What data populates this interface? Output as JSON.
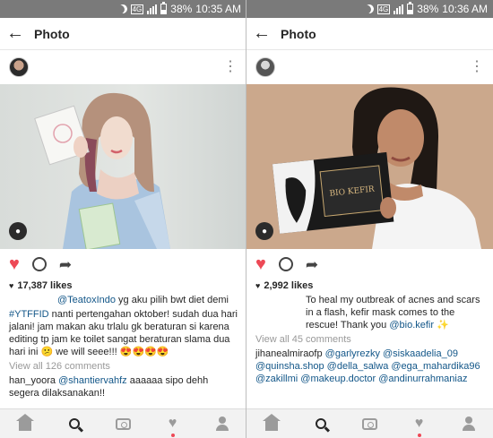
{
  "left": {
    "status": {
      "network": "4G",
      "battery": "38%",
      "time": "10:35 AM"
    },
    "header": {
      "title": "Photo",
      "back_icon": "arrow-left-icon"
    },
    "likes": "17,387 likes",
    "caption": {
      "mention": "@TeatoxIndo",
      "line1_rest": " yg aku pilih bwt diet demi",
      "hashtag": "#YTFFID",
      "line2_rest": " nanti pertengahan oktober! sudah dua hari jalani! jam makan aku trlalu gk beraturan si karena editing tp jam ke toilet sangat beraturan slama dua hari ini ",
      "emoji1": "😕",
      "line3": " we will seee!!! ",
      "emoji2": "😍😍😍😍"
    },
    "view_all": "View all 126 comments",
    "comment": {
      "user": "han_yoora",
      "mention": "@shantiervahfz",
      "text": " aaaaaa sipo dehh segera dilaksanakan!!"
    }
  },
  "right": {
    "status": {
      "network": "4G",
      "battery": "38%",
      "time": "10:36 AM"
    },
    "header": {
      "title": "Photo",
      "back_icon": "arrow-left-icon"
    },
    "likes": "2,992 likes",
    "caption": {
      "text": "To heal my outbreak of acnes and scars in a flash, kefir mask comes to the rescue! Thank you ",
      "mention": "@bio.kefir",
      "emoji": "✨"
    },
    "view_all": "View all 45 comments",
    "comment": {
      "user": "jihanealmiraofp",
      "mentions": "@garlyrezky @siskaadelia_09 @quinsha.shop @della_salwa @ega_mahardika96 @zakillmi @makeup.doctor @andinurrahmaniaz"
    },
    "product_text": "BIO KEFIR"
  },
  "colors": {
    "accent": "#ed4956",
    "link": "#125688",
    "statusbar": "#7a7a7a"
  }
}
